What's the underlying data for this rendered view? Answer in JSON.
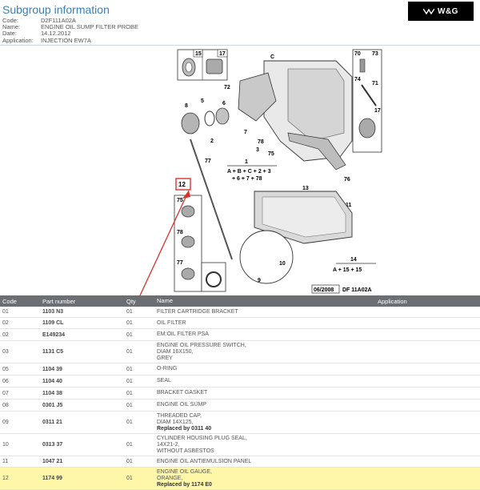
{
  "header": {
    "title": "Subgroup information",
    "fields": [
      {
        "label": "Code:",
        "value": "D2F111A02A"
      },
      {
        "label": "Name:",
        "value": "ENGINE OIL SUMP FILTER PROBE"
      },
      {
        "label": "Date:",
        "value": "14.12.2012"
      },
      {
        "label": "Application:",
        "value": "INJECTION EW7A"
      }
    ],
    "logo": "W&G"
  },
  "diagram": {
    "callouts": [
      "15",
      "17",
      "70",
      "73",
      "74",
      "71",
      "C",
      "72",
      "8",
      "5",
      "6",
      "3",
      "2",
      "78",
      "7",
      "1",
      "A + B + C + 2 + 3",
      "+ 6 + 7 + 78",
      "77",
      "12",
      "75",
      "76",
      "13",
      "11",
      "10",
      "9",
      "14",
      "A + 15 + 15",
      "78",
      "77"
    ],
    "ref_date": "06/2008",
    "ref_code": "DF 11A02A"
  },
  "table": {
    "columns": {
      "code": "Code",
      "part": "Part number",
      "qty": "Qty",
      "name": "Name",
      "app": "Application"
    },
    "rows": [
      {
        "code": "01",
        "part": "1103 N3",
        "qty": "01",
        "name": [
          "FILTER CARTRIDGE BRACKET"
        ],
        "replaced": ""
      },
      {
        "code": "02",
        "part": "1109 CL",
        "qty": "01",
        "name": [
          "OIL FILTER"
        ],
        "replaced": ""
      },
      {
        "code": "02",
        "part": "E149234",
        "qty": "01",
        "name": [
          "EM:OIL FILTER PSA"
        ],
        "replaced": ""
      },
      {
        "code": "03",
        "part": "1131 C5",
        "qty": "01",
        "name": [
          "ENGINE OIL PRESSURE SWITCH,",
          "DIAM 16X150,",
          "GREY"
        ],
        "replaced": ""
      },
      {
        "code": "05",
        "part": "1104 39",
        "qty": "01",
        "name": [
          "O-RING"
        ],
        "replaced": ""
      },
      {
        "code": "06",
        "part": "1104 40",
        "qty": "01",
        "name": [
          "SEAL"
        ],
        "replaced": ""
      },
      {
        "code": "07",
        "part": "1104 38",
        "qty": "01",
        "name": [
          "BRACKET GASKET"
        ],
        "replaced": ""
      },
      {
        "code": "08",
        "part": "0301 J5",
        "qty": "01",
        "name": [
          "ENGINE OIL SUMP"
        ],
        "replaced": ""
      },
      {
        "code": "09",
        "part": "0311 21",
        "qty": "01",
        "name": [
          "THREADED CAP,",
          "DIAM 14X125,"
        ],
        "replaced": "Replaced by 0311 40"
      },
      {
        "code": "10",
        "part": "0313 37",
        "qty": "01",
        "name": [
          "CYLINDER HOUSING PLUG SEAL,",
          "14X21-2,",
          "WITHOUT ASBESTOS"
        ],
        "replaced": ""
      },
      {
        "code": "11",
        "part": "1047 21",
        "qty": "01",
        "name": [
          "ENGINE OIL ANTIEMULSION PANEL"
        ],
        "replaced": ""
      },
      {
        "code": "12",
        "part": "1174 99",
        "qty": "01",
        "name": [
          "ENGINE OIL GAUGE,",
          "ORANGE,"
        ],
        "replaced": "Replaced by 1174 E0",
        "highlight": true
      }
    ]
  },
  "colors": {
    "accent": "#3c7fb2",
    "header_bg": "#6b6f73",
    "highlight": "#fff7a8",
    "arrow": "#d8322d"
  }
}
